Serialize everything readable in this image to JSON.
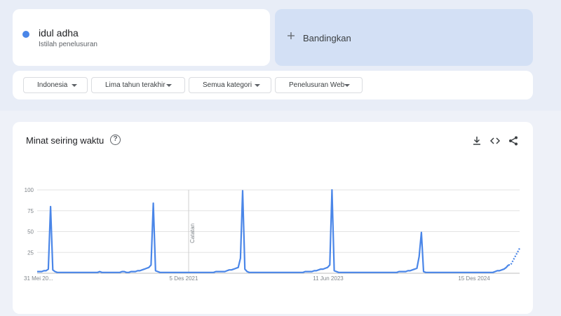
{
  "search_term": {
    "name": "idul adha",
    "subtitle": "Istilah penelusuran",
    "color": "#4a86e8"
  },
  "compare": {
    "label": "Bandingkan"
  },
  "filters": [
    "Indonesia",
    "Lima tahun terakhir",
    "Semua kategori",
    "Penelusuran Web"
  ],
  "panel": {
    "title": "Minat seiring waktu",
    "help_icon": "help-icon",
    "tools": [
      "download-icon",
      "embed-icon",
      "share-icon"
    ]
  },
  "chart_data": {
    "type": "line",
    "ylim": [
      0,
      100
    ],
    "y_ticks": [
      "100",
      "75",
      "50",
      "25"
    ],
    "x_tick_labels": [
      "31 Mei 20...",
      "5 Des 2021",
      "11 Jun 2023",
      "15 Des 2024"
    ],
    "annotation": "Catatan",
    "series_color": "#4a86e8",
    "series": [
      {
        "values": [
          2,
          2,
          2,
          3,
          3,
          5,
          80,
          4,
          2,
          1,
          1,
          1,
          1,
          1,
          1,
          1,
          1,
          1,
          1,
          1,
          1,
          1,
          1,
          1,
          1,
          1,
          1,
          1,
          2,
          1,
          1,
          1,
          1,
          1,
          1,
          1,
          1,
          1,
          2,
          2,
          1,
          1,
          2,
          2,
          2,
          3,
          3,
          4,
          5,
          6,
          7,
          10,
          84,
          3,
          2,
          1,
          1,
          1,
          1,
          1,
          1,
          1,
          1,
          1,
          1,
          1,
          1,
          1,
          1,
          1,
          1,
          1,
          1,
          1,
          1,
          1,
          1,
          1,
          1,
          1,
          2,
          2,
          2,
          2,
          2,
          3,
          4,
          4,
          5,
          6,
          7,
          18,
          99,
          5,
          2,
          1,
          1,
          1,
          1,
          1,
          1,
          1,
          1,
          1,
          1,
          1,
          1,
          1,
          1,
          1,
          1,
          1,
          1,
          1,
          1,
          1,
          1,
          1,
          1,
          1,
          2,
          2,
          2,
          2,
          3,
          3,
          4,
          5,
          5,
          6,
          7,
          10,
          100,
          3,
          2,
          1,
          1,
          1,
          1,
          1,
          1,
          1,
          1,
          1,
          1,
          1,
          1,
          1,
          1,
          1,
          1,
          1,
          1,
          1,
          1,
          1,
          1,
          1,
          1,
          1,
          1,
          1,
          2,
          2,
          2,
          2,
          3,
          3,
          4,
          5,
          6,
          20,
          49,
          2,
          1,
          1,
          1,
          1,
          1,
          1,
          1,
          1,
          1,
          1,
          1,
          1,
          1,
          1,
          1,
          1,
          1,
          1,
          1,
          1,
          1,
          1,
          1,
          1,
          1,
          1,
          1,
          1,
          1,
          1,
          1,
          2,
          3,
          3,
          4,
          5,
          7,
          10
        ],
        "partial": [
          10,
          15,
          20,
          25,
          30
        ]
      }
    ]
  }
}
